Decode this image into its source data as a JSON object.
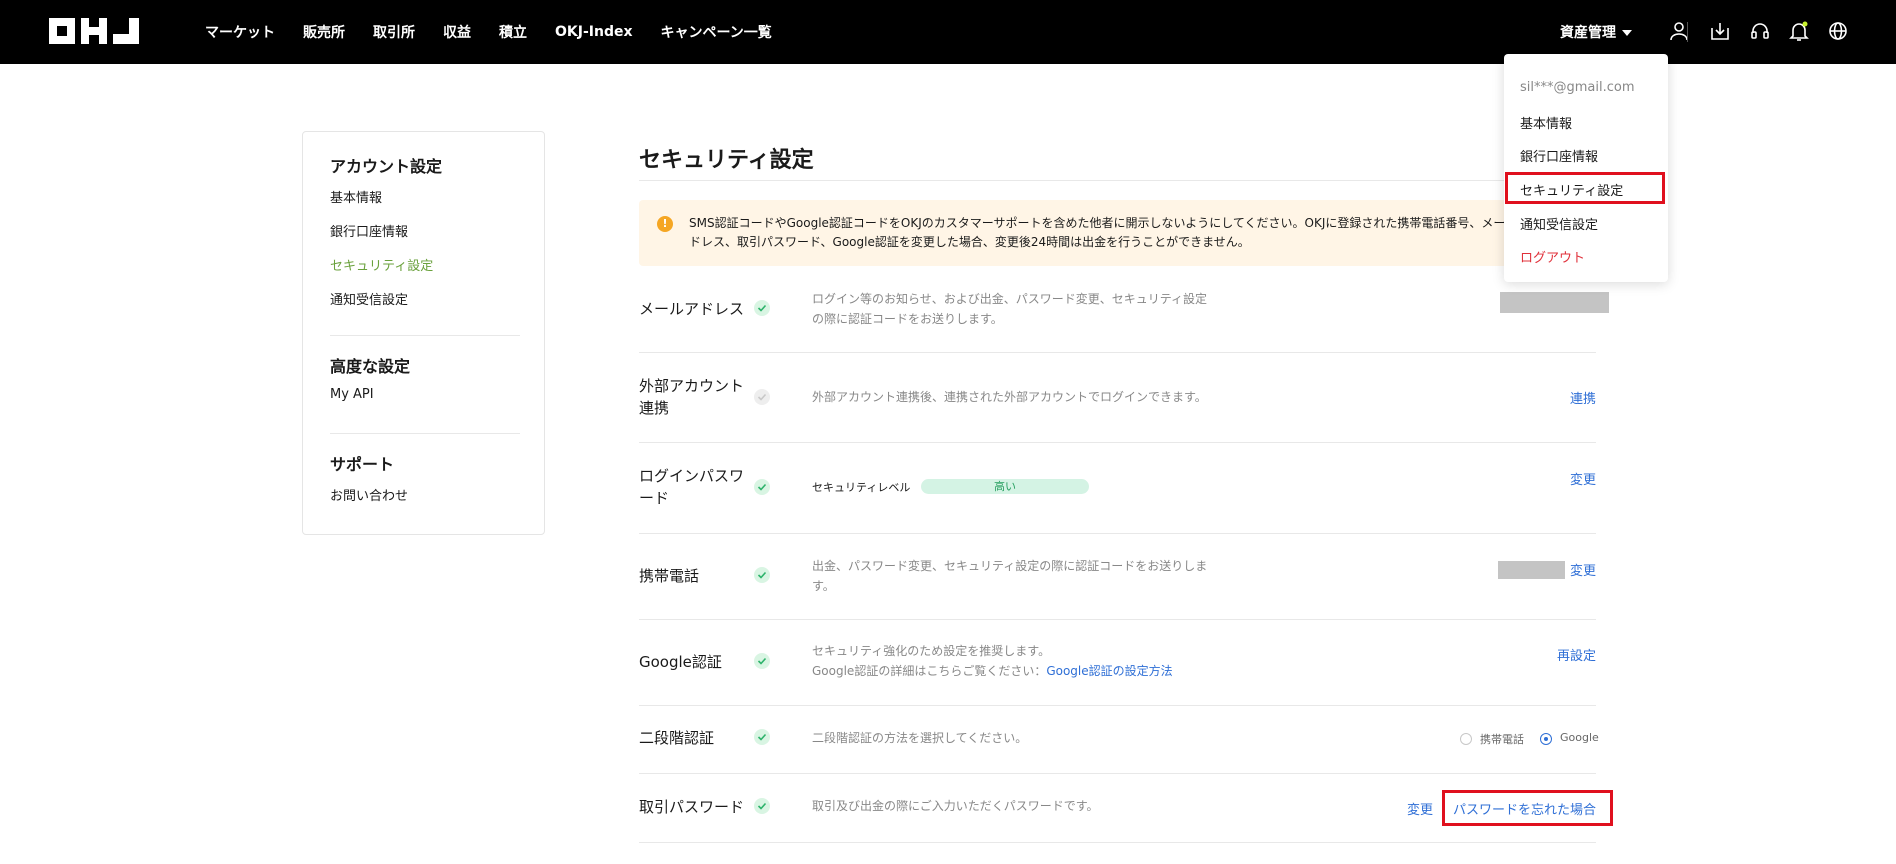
{
  "nav": {
    "logo_alt": "OKJ",
    "links": [
      "マーケット",
      "販売所",
      "取引所",
      "収益",
      "積立",
      "OKJ-Index",
      "キャンペーン一覧"
    ],
    "asset_menu": "資産管理",
    "icons": [
      "user-icon",
      "download-icon",
      "headset-icon",
      "bell-icon",
      "globe-icon"
    ]
  },
  "dropdown": {
    "email": "sil***@gmail.com",
    "items": [
      "基本情報",
      "銀行口座情報",
      "セキュリティ設定",
      "通知受信設定"
    ],
    "logout": "ログアウト"
  },
  "sidebar": {
    "account_head": "アカウント設定",
    "account_items": [
      "基本情報",
      "銀行口座情報",
      "セキュリティ設定",
      "通知受信設定"
    ],
    "advanced_head": "高度な設定",
    "advanced_items": [
      "My API"
    ],
    "support_head": "サポート",
    "support_items": [
      "お問い合わせ"
    ]
  },
  "main": {
    "title": "セキュリティ設定",
    "alert": "SMS認証コードやGoogle認証コードをOKJのカスタマーサポートを含めた他者に開示しないようにしてください。OKJに登録された携帯電話番号、メールアドレス、取引パスワード、Google認証を変更した場合、変更後24時間は出金を行うことができません。",
    "rows": {
      "email": {
        "label": "メールアドレス",
        "desc": "ログイン等のお知らせ、および出金、パスワード変更、セキュリティ設定の際に認証コードをお送りします。"
      },
      "external": {
        "label": "外部アカウント連携",
        "desc": "外部アカウント連携後、連携された外部アカウントでログインできます。",
        "action": "連携"
      },
      "login_pw": {
        "label": "ログインパスワード",
        "level_label": "セキュリティレベル",
        "level_value": "高い",
        "action": "変更"
      },
      "phone": {
        "label": "携帯電話",
        "desc": "出金、パスワード変更、セキュリティ設定の際に認証コードをお送りします。",
        "action": "変更"
      },
      "google": {
        "label": "Google認証",
        "desc1": "セキュリティ強化のため設定を推奨します。",
        "desc2": "Google認証の詳細はこちらご覧ください：",
        "desc_link": "Google認証の設定方法",
        "action": "再設定"
      },
      "two_factor": {
        "label": "二段階認証",
        "desc": "二段階認証の方法を選択してください。",
        "option_phone": "携帯電話",
        "option_google": "Google",
        "selected": "Google"
      },
      "trade_pw": {
        "label": "取引パスワード",
        "desc": "取引及び出金の際にご入力いただくパスワードです。",
        "action_change": "変更",
        "action_forgot": "パスワードを忘れた場合"
      }
    }
  },
  "colors": {
    "accent_green": "#6aa13c",
    "link_blue": "#2f6fd6",
    "highlight_red": "#e0101e",
    "alert_bg": "#fff5e6"
  }
}
